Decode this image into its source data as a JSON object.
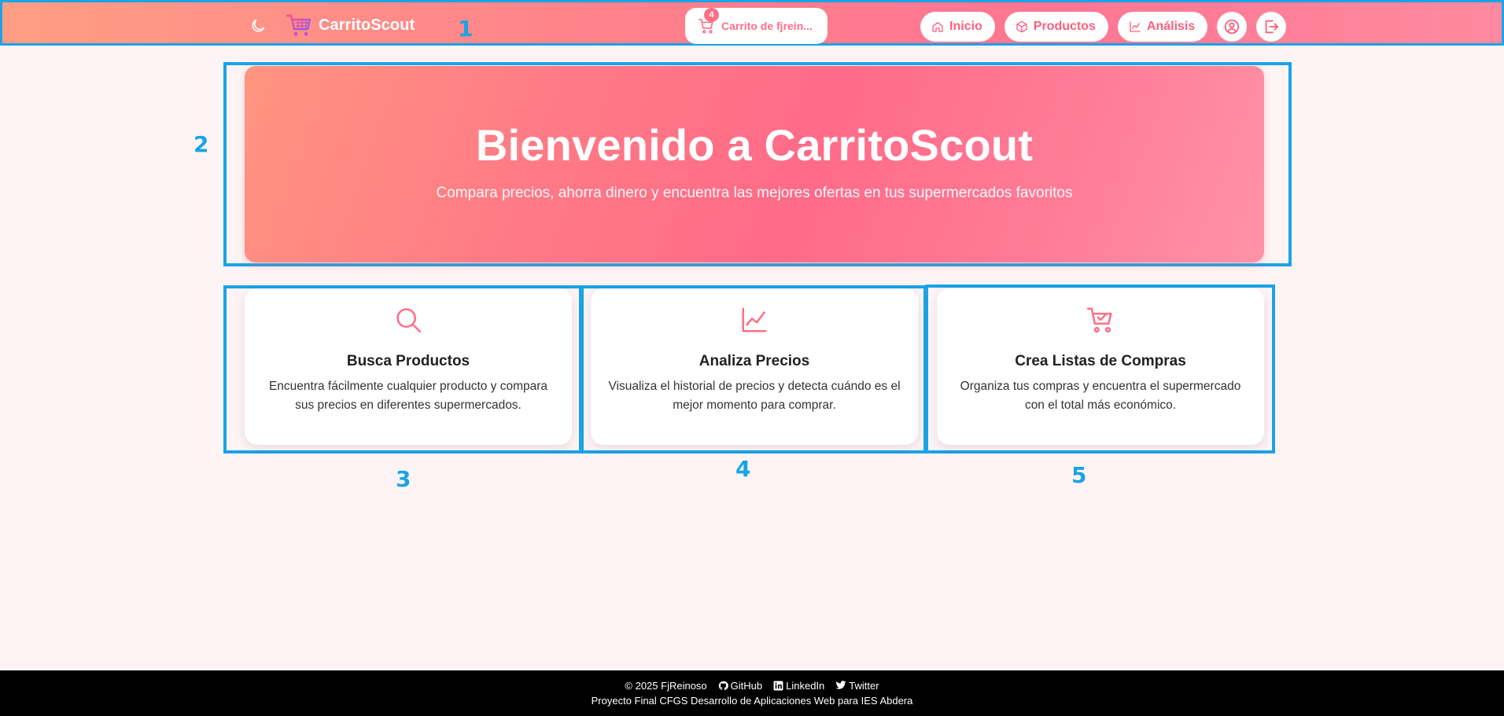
{
  "navbar": {
    "brand_name": "CarritoScout",
    "cart_label": "Carrito de fjrein...",
    "cart_count": "4",
    "links": [
      {
        "label": "Inicio",
        "icon": "home-icon"
      },
      {
        "label": "Productos",
        "icon": "box-icon"
      },
      {
        "label": "Análisis",
        "icon": "chart-line-icon"
      }
    ],
    "icons": {
      "theme": "moon-icon",
      "profile": "user-circle-icon",
      "logout": "logout-icon"
    }
  },
  "hero": {
    "title": "Bienvenido a CarritoScout",
    "subtitle": "Compara precios, ahorra dinero y encuentra las mejores ofertas en tus supermercados favoritos"
  },
  "features": [
    {
      "title": "Busca Productos",
      "description": "Encuentra fácilmente cualquier producto y compara sus precios en diferentes supermercados.",
      "icon": "search-icon"
    },
    {
      "title": "Analiza Precios",
      "description": "Visualiza el historial de precios y detecta cuándo es el mejor momento para comprar.",
      "icon": "chart-line-icon"
    },
    {
      "title": "Crea Listas de Compras",
      "description": "Organiza tus compras y encuentra el supermercado con el total más económico.",
      "icon": "cart-check-icon"
    }
  ],
  "annotations": [
    "1",
    "2",
    "3",
    "4",
    "5"
  ],
  "footer": {
    "copyright": "© 2025 FjReinoso",
    "links": [
      "GitHub",
      "LinkedIn",
      "Twitter"
    ],
    "credit": "Proyecto Final CFGS Desarrollo de Aplicaciones Web para IES Abdera"
  },
  "colors": {
    "accent": "#ff6f87",
    "annotation": "#1aa3e6",
    "background": "#fff4f5",
    "footer": "#000000"
  }
}
